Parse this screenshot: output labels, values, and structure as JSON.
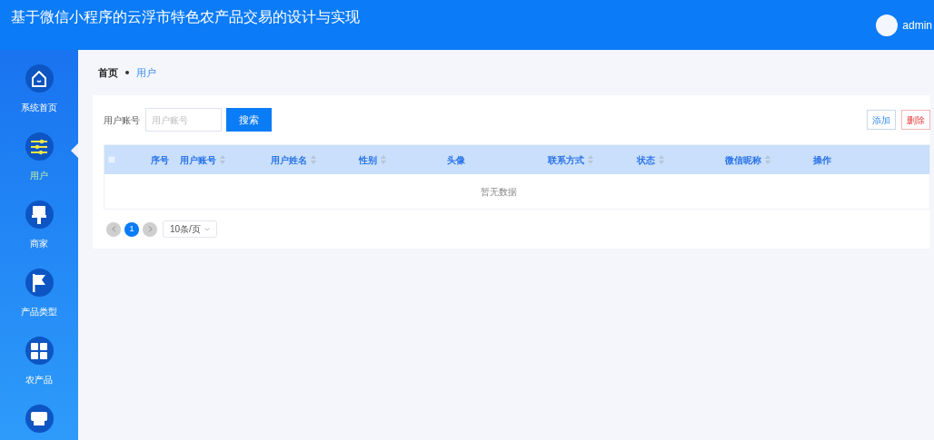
{
  "header": {
    "title": "基于微信小程序的云浮市特色农产品交易的设计与实现",
    "user": "admin"
  },
  "sidebar": {
    "items": [
      {
        "kind": "home",
        "label": "系统首页",
        "selected": false
      },
      {
        "kind": "sliders",
        "label": "用户",
        "selected": true
      },
      {
        "kind": "brush",
        "label": "商家",
        "selected": false
      },
      {
        "kind": "flag",
        "label": "产品类型",
        "selected": false
      },
      {
        "kind": "grid",
        "label": "农产品",
        "selected": false
      },
      {
        "kind": "shop",
        "selected": false
      }
    ]
  },
  "breadcrumb": [
    {
      "label": "首页",
      "current": false
    },
    {
      "label": "用户",
      "current": true
    }
  ],
  "search": {
    "label": "用户账号",
    "placeholder": "用户账号",
    "button": "搜索"
  },
  "actions": [
    {
      "kind": "add",
      "label": "添加"
    },
    {
      "kind": "delete",
      "label": "删除"
    }
  ],
  "table": {
    "all_checked": false,
    "columns": [
      {
        "label": "序号",
        "sortable": false
      },
      {
        "label": "用户账号",
        "sortable": true
      },
      {
        "label": "用户姓名",
        "sortable": true
      },
      {
        "label": "性别",
        "sortable": true
      },
      {
        "label": "头像",
        "sortable": false
      },
      {
        "label": "联系方式",
        "sortable": true
      },
      {
        "label": "状态",
        "sortable": true
      },
      {
        "label": "微信昵称",
        "sortable": true
      },
      {
        "label": "操作",
        "sortable": false
      }
    ],
    "empty": "暂无数据"
  },
  "pagination": {
    "pages": [
      {
        "label": "1",
        "selected": true
      }
    ],
    "page_size": "10条/页"
  }
}
